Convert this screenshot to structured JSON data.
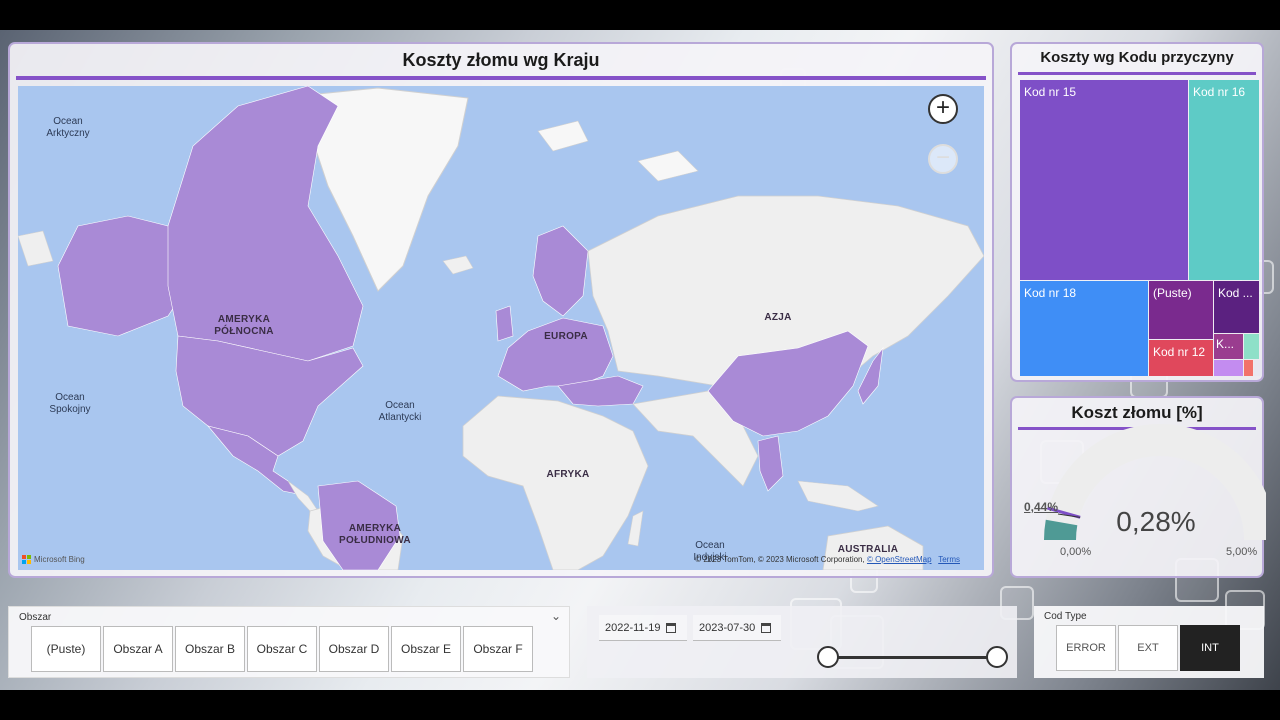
{
  "map": {
    "title": "Koszty złomu wg Kraju",
    "labels": {
      "ocean_arctic": "Ocean Arktyczny",
      "ocean_pacific": "Ocean Spokojny",
      "ocean_atlantic": "Ocean Atlantycki",
      "ocean_indian": "Ocean Indyjski",
      "north_america": "AMERYKA PÓŁNOCNA",
      "south_america": "AMERYKA POŁUDNIOWA",
      "europe": "EUROPA",
      "asia": "AZJA",
      "africa": "AFRYKA",
      "australia": "AUSTRALIA"
    },
    "zoom_in_icon": "plus-icon",
    "zoom_out_icon": "minus-icon",
    "bing_label": "Microsoft Bing",
    "copyright_text": "© 2023 TomTom, © 2023 Microsoft Corporation,",
    "osm_link": "© OpenStreetMap",
    "terms_link": "Terms",
    "highlight_color": "#a98ad6"
  },
  "treemap": {
    "title": "Koszty wg Kodu przyczyny",
    "tiles": [
      {
        "label": "Kod nr 15",
        "color": "#7e4fc7"
      },
      {
        "label": "Kod nr 16",
        "color": "#5ecbc6"
      },
      {
        "label": "Kod nr 18",
        "color": "#3f8ef6"
      },
      {
        "label": "(Puste)",
        "color": "#7a2a8e"
      },
      {
        "label": "Kod ...",
        "color": "#5b2180"
      },
      {
        "label": "Kod nr 12",
        "color": "#e0485c"
      },
      {
        "label": "K...",
        "color": "#9a3d8f"
      }
    ]
  },
  "gauge": {
    "title": "Koszt złomu [%]",
    "value": "0,28%",
    "target": "0,44%",
    "min": "0,00%",
    "max": "5,00%"
  },
  "area_slicer": {
    "title": "Obszar",
    "options": [
      "(Puste)",
      "Obszar A",
      "Obszar B",
      "Obszar C",
      "Obszar D",
      "Obszar E",
      "Obszar F"
    ]
  },
  "date_slicer": {
    "start": "2022-11-19",
    "end": "2023-07-30"
  },
  "code_slicer": {
    "title": "Cod Type",
    "options": [
      "ERROR",
      "EXT",
      "INT"
    ],
    "selected": "INT"
  }
}
